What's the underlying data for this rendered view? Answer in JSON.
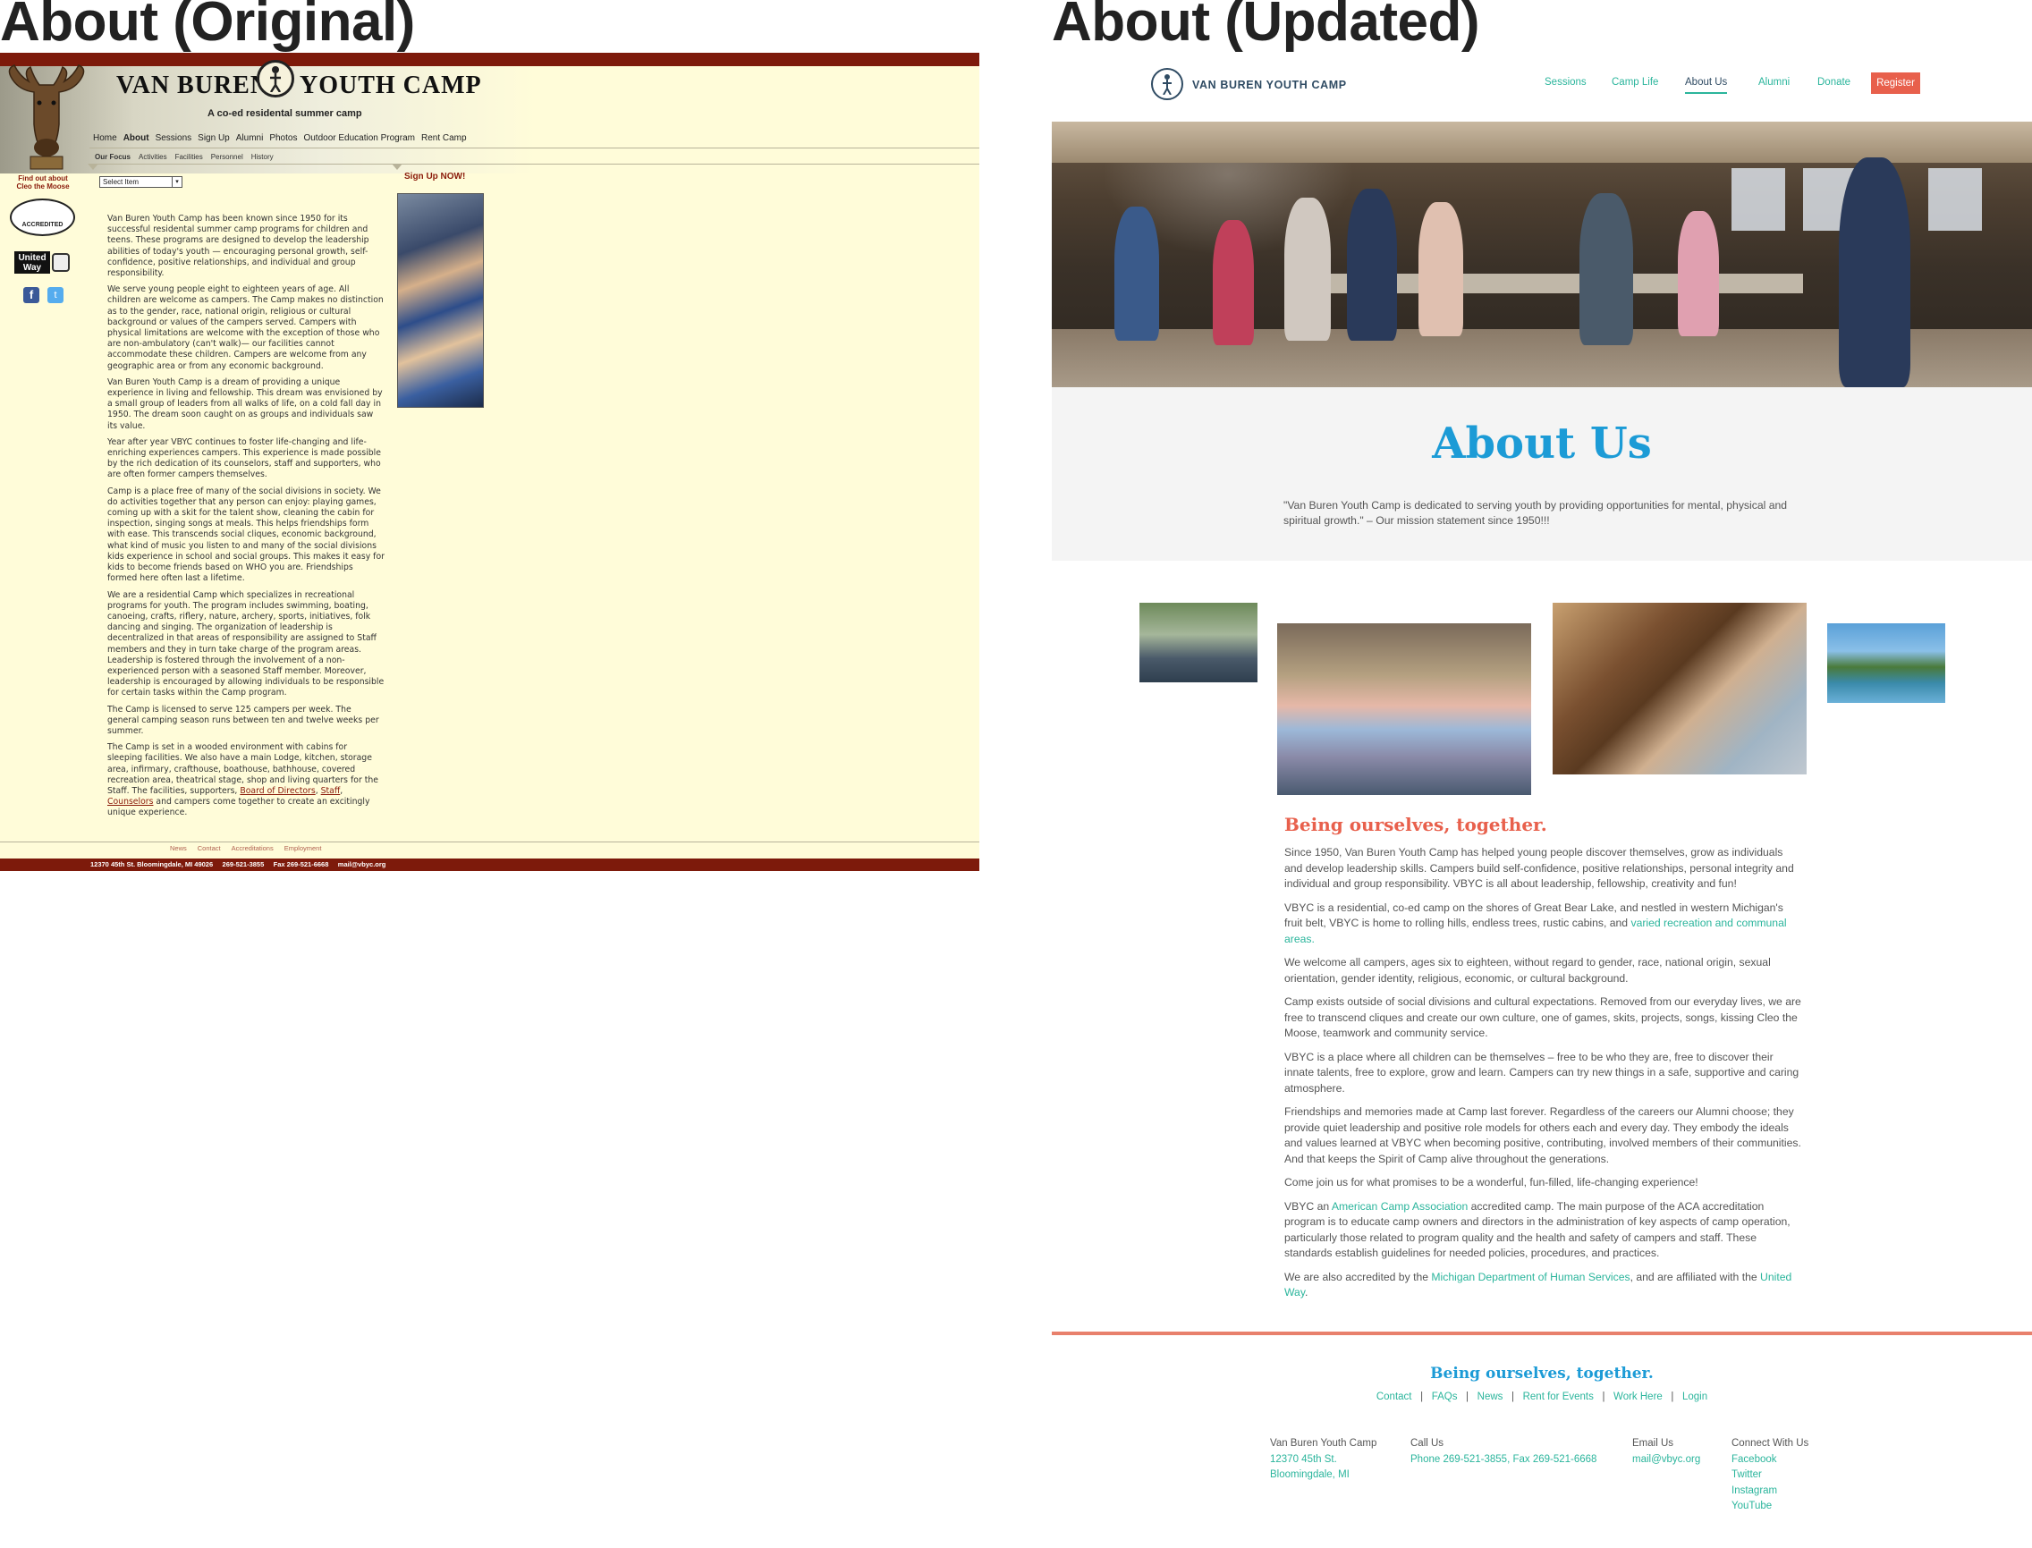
{
  "headings": {
    "left": "About (Original)",
    "right": "About (Updated)"
  },
  "original": {
    "camp_title_left": "VAN BUREN",
    "camp_title_right": "YOUTH CAMP",
    "tagline": "A co-ed residental summer camp",
    "nav": [
      "Home",
      "About",
      "Sessions",
      "Sign Up",
      "Alumni",
      "Photos",
      "Outdoor Education Program",
      "Rent Camp"
    ],
    "subnav": [
      "Our Focus",
      "Activities",
      "Facilities",
      "Personnel",
      "History"
    ],
    "cleo_line1": "Find out about",
    "cleo_line2": "Cleo the Moose",
    "select_value": "Select Item",
    "signup": "Sign Up NOW!",
    "aca_label": "ACCREDITED",
    "uw_label": "United Way",
    "fb_glyph": "f",
    "tw_glyph": "t",
    "paragraphs": [
      "Van Buren Youth Camp has been known since 1950 for its successful residental summer camp programs for children and teens. These programs are designed to develop the leadership abilities of today's youth — encouraging personal growth, self-confidence, positive relationships, and individual and group responsibility.",
      "We serve young people eight to eighteen years of age. All children are welcome as campers. The Camp makes no distinction as to the gender, race, national origin, religious or cultural background or values of the campers served. Campers with physical limitations are welcome with the exception of those who are non-ambulatory (can't walk)— our facilities cannot accommodate these children. Campers are welcome from any geographic area or from any economic background.",
      "Van Buren Youth Camp is a dream of providing a unique experience in living and fellowship. This dream was envisioned by a small group of leaders from all walks of life, on a cold fall day in 1950. The dream soon caught on as groups and individuals saw its value.",
      "Year after year VBYC continues to foster life-changing and life-enriching experiences campers. This experience is made possible by the rich dedication of its counselors, staff and supporters, who are often former campers themselves.",
      "Camp is a place free of many of the social divisions in society. We do activities together that any person can enjoy: playing games, coming up with a skit for the talent show, cleaning the cabin for inspection, singing songs at meals. This helps friendships form with ease. This transcends social cliques, economic background, what kind of music you listen to and many of the social divisions kids experience in school and social groups. This makes it easy for kids to become friends based on WHO you are. Friendships formed here often last a lifetime.",
      "We are a residential Camp which specializes in recreational programs for youth. The program includes swimming, boating, canoeing, crafts, riflery, nature, archery, sports, initiatives, folk dancing and singing. The organization of leadership is decentralized in that areas of responsibility are assigned to Staff members and they in turn take charge of the program areas. Leadership is fostered through the involvement of a non-experienced person with a seasoned Staff member. Moreover, leadership is encouraged by allowing individuals to be responsible for certain tasks within the Camp program.",
      "The Camp is licensed to serve 125 campers per week. The general camping season runs between ten and twelve weeks per summer."
    ],
    "last_para_start": "The Camp is set in a wooded environment with cabins for sleeping facilities. We also have a main Lodge, kitchen, storage area, infirmary, crafthouse, boathouse, bathhouse, covered recreation area, theatrical stage, shop and living quarters for the Staff. The facilities, supporters, ",
    "last_para_link1": "Board of Directors",
    "last_para_comma": ", ",
    "last_para_link2": "Staff",
    "last_para_comma2": ", ",
    "last_para_link3": "Counselors",
    "last_para_end": " and campers come together to create an excitingly unique experience.",
    "footer_links": [
      "News",
      "Contact",
      "Accreditations",
      "Employment"
    ],
    "footer_bar": "12370 45th St. Bloomingdale, MI 49026     269-521-3855     Fax 269-521-6668     mail@vbyc.org"
  },
  "updated": {
    "brand": "VAN BUREN YOUTH CAMP",
    "nav": {
      "sessions": "Sessions",
      "camp_life": "Camp Life",
      "about": "About Us",
      "alumni": "Alumni",
      "donate": "Donate"
    },
    "register": "Register",
    "title": "About Us",
    "mission": "\"Van Buren Youth Camp is dedicated to serving youth by providing opportunities for mental, physical and spiritual growth.\" – Our mission statement since 1950!!!",
    "subtitle": "Being ourselves, together.",
    "p1": "Since 1950, Van Buren Youth Camp has helped young people discover themselves, grow as individuals and develop leadership skills. Campers build self-confidence, positive relationships, personal integrity and individual and group responsibility. VBYC is all about leadership, fellowship, creativity and fun!",
    "p2_start": "VBYC is a residential, co-ed camp on the shores of Great Bear Lake, and nestled in western Michigan's fruit belt, VBYC is home to rolling hills, endless trees, rustic cabins, and ",
    "p2_link": "varied recreation and communal areas.",
    "p3": "We welcome all campers, ages six to eighteen, without regard to gender, race, national origin, sexual orientation, gender identity, religious, economic, or cultural background.",
    "p4": "Camp exists outside of social divisions and cultural expectations. Removed from our everyday lives, we are free to transcend cliques and create our own culture, one of games, skits, projects, songs, kissing Cleo the Moose, teamwork and community service.",
    "p5": "VBYC is a place where all children can be themselves – free to be who they are, free to discover their innate talents, free to explore, grow and learn. Campers can try new things in a safe, supportive and caring atmosphere.",
    "p6": "Friendships and memories made at Camp last forever. Regardless of the careers our Alumni choose; they provide quiet leadership and positive role models for others each and every day. They embody the ideals and values learned at VBYC when becoming positive, contributing, involved members of their communities. And that keeps the Spirit of Camp alive throughout the generations.",
    "p7": "Come join us for what promises to be a wonderful, fun-filled, life-changing experience!",
    "p8_start": "VBYC an ",
    "p8_link": "American Camp Association",
    "p8_end": " accredited camp. The main purpose of the ACA accreditation program is to educate camp owners and directors in the administration of key aspects of camp operation, particularly those related to program quality and the health and safety of campers and staff. These standards establish guidelines for needed policies, procedures, and practices.",
    "p9_start": "We are also accredited by the ",
    "p9_link1": "Michigan Department of Human Services",
    "p9_mid": ", and are affiliated with the ",
    "p9_link2": "United Way",
    "p9_end": ".",
    "footer_title": "Being ourselves, together.",
    "footer_links": {
      "contact": "Contact",
      "faqs": "FAQs",
      "news": "News",
      "rent": "Rent for Events",
      "work": "Work Here",
      "login": "Login",
      "sep": "|"
    },
    "footer": {
      "col1_label": "Van Buren Youth Camp",
      "col1_line1": "12370 45th St.",
      "col1_line2": "Bloomingdale, MI",
      "col2_label": "Call Us",
      "col2_value": "Phone 269-521-3855, Fax 269-521-6668",
      "col3_label": "Email Us",
      "col3_value": "mail@vbyc.org",
      "col4_label": "Connect With Us",
      "col4_items": [
        "Facebook",
        "Twitter",
        "Instagram",
        "YouTube"
      ]
    },
    "colors": {
      "teal": "#2bb59c",
      "blue": "#1c9bd6",
      "coral": "#e8604c",
      "navy": "#2f4b63"
    }
  }
}
